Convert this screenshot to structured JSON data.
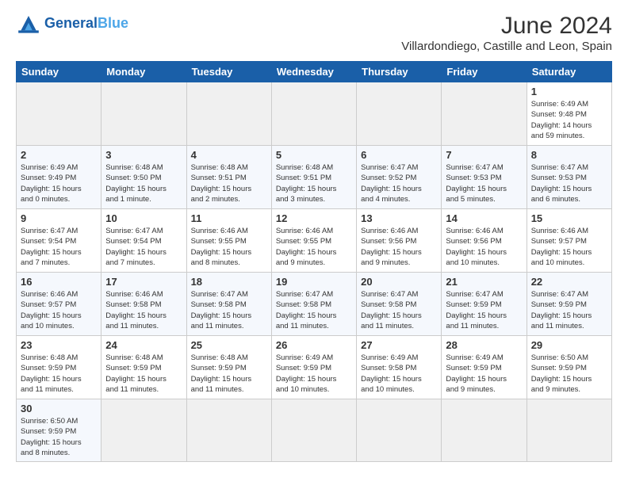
{
  "header": {
    "logo_general": "General",
    "logo_blue": "Blue",
    "month": "June 2024",
    "location": "Villardondiego, Castille and Leon, Spain"
  },
  "weekdays": [
    "Sunday",
    "Monday",
    "Tuesday",
    "Wednesday",
    "Thursday",
    "Friday",
    "Saturday"
  ],
  "weeks": [
    [
      {
        "day": "",
        "info": ""
      },
      {
        "day": "",
        "info": ""
      },
      {
        "day": "",
        "info": ""
      },
      {
        "day": "",
        "info": ""
      },
      {
        "day": "",
        "info": ""
      },
      {
        "day": "",
        "info": ""
      },
      {
        "day": "1",
        "info": "Sunrise: 6:49 AM\nSunset: 9:48 PM\nDaylight: 14 hours\nand 59 minutes."
      }
    ],
    [
      {
        "day": "2",
        "info": "Sunrise: 6:49 AM\nSunset: 9:49 PM\nDaylight: 15 hours\nand 0 minutes."
      },
      {
        "day": "3",
        "info": "Sunrise: 6:48 AM\nSunset: 9:50 PM\nDaylight: 15 hours\nand 1 minute."
      },
      {
        "day": "4",
        "info": "Sunrise: 6:48 AM\nSunset: 9:51 PM\nDaylight: 15 hours\nand 2 minutes."
      },
      {
        "day": "5",
        "info": "Sunrise: 6:48 AM\nSunset: 9:51 PM\nDaylight: 15 hours\nand 3 minutes."
      },
      {
        "day": "6",
        "info": "Sunrise: 6:47 AM\nSunset: 9:52 PM\nDaylight: 15 hours\nand 4 minutes."
      },
      {
        "day": "7",
        "info": "Sunrise: 6:47 AM\nSunset: 9:53 PM\nDaylight: 15 hours\nand 5 minutes."
      },
      {
        "day": "8",
        "info": "Sunrise: 6:47 AM\nSunset: 9:53 PM\nDaylight: 15 hours\nand 6 minutes."
      }
    ],
    [
      {
        "day": "9",
        "info": "Sunrise: 6:47 AM\nSunset: 9:54 PM\nDaylight: 15 hours\nand 7 minutes."
      },
      {
        "day": "10",
        "info": "Sunrise: 6:47 AM\nSunset: 9:54 PM\nDaylight: 15 hours\nand 7 minutes."
      },
      {
        "day": "11",
        "info": "Sunrise: 6:46 AM\nSunset: 9:55 PM\nDaylight: 15 hours\nand 8 minutes."
      },
      {
        "day": "12",
        "info": "Sunrise: 6:46 AM\nSunset: 9:55 PM\nDaylight: 15 hours\nand 9 minutes."
      },
      {
        "day": "13",
        "info": "Sunrise: 6:46 AM\nSunset: 9:56 PM\nDaylight: 15 hours\nand 9 minutes."
      },
      {
        "day": "14",
        "info": "Sunrise: 6:46 AM\nSunset: 9:56 PM\nDaylight: 15 hours\nand 10 minutes."
      },
      {
        "day": "15",
        "info": "Sunrise: 6:46 AM\nSunset: 9:57 PM\nDaylight: 15 hours\nand 10 minutes."
      }
    ],
    [
      {
        "day": "16",
        "info": "Sunrise: 6:46 AM\nSunset: 9:57 PM\nDaylight: 15 hours\nand 10 minutes."
      },
      {
        "day": "17",
        "info": "Sunrise: 6:46 AM\nSunset: 9:58 PM\nDaylight: 15 hours\nand 11 minutes."
      },
      {
        "day": "18",
        "info": "Sunrise: 6:47 AM\nSunset: 9:58 PM\nDaylight: 15 hours\nand 11 minutes."
      },
      {
        "day": "19",
        "info": "Sunrise: 6:47 AM\nSunset: 9:58 PM\nDaylight: 15 hours\nand 11 minutes."
      },
      {
        "day": "20",
        "info": "Sunrise: 6:47 AM\nSunset: 9:58 PM\nDaylight: 15 hours\nand 11 minutes."
      },
      {
        "day": "21",
        "info": "Sunrise: 6:47 AM\nSunset: 9:59 PM\nDaylight: 15 hours\nand 11 minutes."
      },
      {
        "day": "22",
        "info": "Sunrise: 6:47 AM\nSunset: 9:59 PM\nDaylight: 15 hours\nand 11 minutes."
      }
    ],
    [
      {
        "day": "23",
        "info": "Sunrise: 6:48 AM\nSunset: 9:59 PM\nDaylight: 15 hours\nand 11 minutes."
      },
      {
        "day": "24",
        "info": "Sunrise: 6:48 AM\nSunset: 9:59 PM\nDaylight: 15 hours\nand 11 minutes."
      },
      {
        "day": "25",
        "info": "Sunrise: 6:48 AM\nSunset: 9:59 PM\nDaylight: 15 hours\nand 11 minutes."
      },
      {
        "day": "26",
        "info": "Sunrise: 6:49 AM\nSunset: 9:59 PM\nDaylight: 15 hours\nand 10 minutes."
      },
      {
        "day": "27",
        "info": "Sunrise: 6:49 AM\nSunset: 9:58 PM\nDaylight: 15 hours\nand 10 minutes."
      },
      {
        "day": "28",
        "info": "Sunrise: 6:49 AM\nSunset: 9:59 PM\nDaylight: 15 hours\nand 9 minutes."
      },
      {
        "day": "29",
        "info": "Sunrise: 6:50 AM\nSunset: 9:59 PM\nDaylight: 15 hours\nand 9 minutes."
      }
    ],
    [
      {
        "day": "30",
        "info": "Sunrise: 6:50 AM\nSunset: 9:59 PM\nDaylight: 15 hours\nand 8 minutes."
      },
      {
        "day": "",
        "info": ""
      },
      {
        "day": "",
        "info": ""
      },
      {
        "day": "",
        "info": ""
      },
      {
        "day": "",
        "info": ""
      },
      {
        "day": "",
        "info": ""
      },
      {
        "day": "",
        "info": ""
      }
    ]
  ]
}
